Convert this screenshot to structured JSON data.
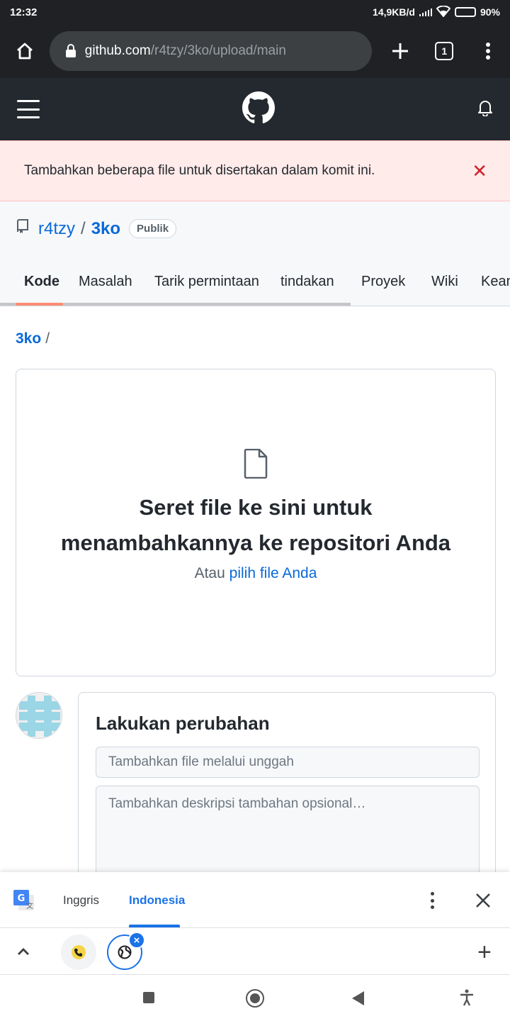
{
  "status": {
    "time": "12:32",
    "network_speed": "14,9KB/d",
    "battery": "90%",
    "battery_level": 0.9
  },
  "browser": {
    "url_host": "github.com",
    "url_path": "/r4tzy/3ko/upload/main",
    "tab_count": "1",
    "icons": [
      "home-icon",
      "lock-icon",
      "plus-icon",
      "tab-switcher-icon",
      "more-vertical-icon"
    ]
  },
  "flash": {
    "message": "Tambahkan beberapa file untuk disertakan dalam komit ini.",
    "close_glyph": "✕"
  },
  "repo": {
    "owner": "r4tzy",
    "separator": "/",
    "name": "3ko",
    "visibility": "Publik"
  },
  "tabs": [
    {
      "label": "Kode"
    },
    {
      "label": "Masalah"
    },
    {
      "label": "Tarik permintaan"
    },
    {
      "label": "tindakan"
    },
    {
      "label": "Proyek"
    },
    {
      "label": "Wiki"
    },
    {
      "label": "Keamanan"
    }
  ],
  "breadcrumb": {
    "repo": "3ko",
    "separator": "/"
  },
  "dropzone": {
    "title_line1": "Seret file ke sini untuk",
    "title_line2": "menambahkannya ke repositori Anda",
    "sub_prefix": "Atau",
    "sub_link": "pilih file Anda"
  },
  "commit": {
    "title": "Lakukan perubahan",
    "summary_placeholder": "Tambahkan file melalui unggah",
    "description_placeholder": "Tambahkan deskripsi tambahan opsional…"
  },
  "translate": {
    "source_lang": "Inggris",
    "target_lang": "Indonesia"
  },
  "colors": {
    "accent": "#0969da",
    "flash_bg": "#ffebe9",
    "danger": "#cf222e",
    "header_bg": "#24292f",
    "translate_accent": "#1a73e8"
  }
}
